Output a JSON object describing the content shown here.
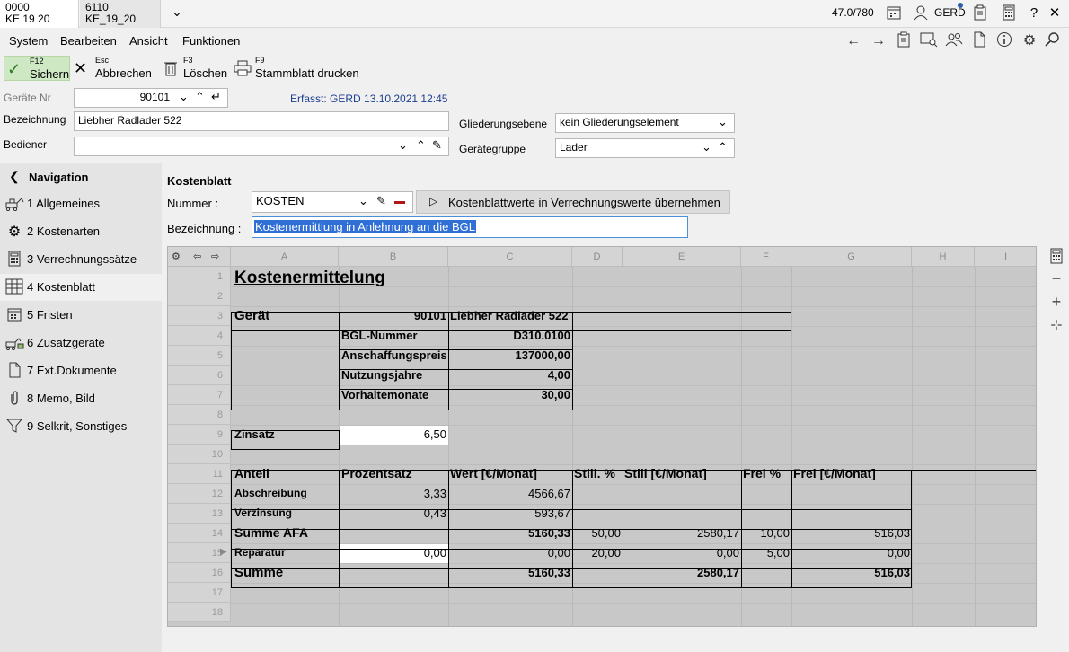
{
  "tabs": [
    {
      "line1": "0000",
      "line2": "KE 19 20"
    },
    {
      "line1": "6110",
      "line2": "KE_19_20"
    }
  ],
  "topbar": {
    "counter": "47.0/780",
    "user": "GERD",
    "icons": [
      "chevron-down-icon",
      "calendar-icon",
      "user-icon",
      "clipboard-icon",
      "calculator-icon",
      "help-icon",
      "close-icon"
    ]
  },
  "menu": [
    "System",
    "Bearbeiten",
    "Ansicht",
    "Funktionen"
  ],
  "toolbar": {
    "save": {
      "key": "F12",
      "label": "Sichern"
    },
    "cancel": {
      "key": "Esc",
      "label": "Abbrechen"
    },
    "delete": {
      "key": "F3",
      "label": "Löschen"
    },
    "print": {
      "key": "F9",
      "label": "Stammblatt drucken"
    }
  },
  "form": {
    "geraete_nr_label": "Geräte Nr",
    "geraete_nr": "90101",
    "erfasst": "Erfasst: GERD 13.10.2021 12:45",
    "bezeichnung_label": "Bezeichnung",
    "bezeichnung": "Liebher Radlader 522",
    "bediener_label": "Bediener",
    "bediener": "",
    "gliederung_label": "Gliederungsebene",
    "gliederung": "kein Gliederungselement",
    "geraetegruppe_label": "Gerätegruppe",
    "geraetegruppe": "Lader"
  },
  "sidebar": {
    "title": "Navigation",
    "items": [
      {
        "label": "1 Allgemeines",
        "icon": "excavator-icon"
      },
      {
        "label": "2 Kostenarten",
        "icon": "gears-icon"
      },
      {
        "label": "3 Verrechnungssätze",
        "icon": "calculator-icon"
      },
      {
        "label": "4 Kostenblatt",
        "icon": "grid-icon"
      },
      {
        "label": "5 Fristen",
        "icon": "calendar-icon"
      },
      {
        "label": "6 Zusatzgeräte",
        "icon": "machines-icon"
      },
      {
        "label": "7 Ext.Dokumente",
        "icon": "document-icon"
      },
      {
        "label": "8 Memo, Bild",
        "icon": "paperclip-icon"
      },
      {
        "label": "9 Selkrit, Sonstiges",
        "icon": "filter-icon"
      }
    ]
  },
  "kostenblatt": {
    "title": "Kostenblatt",
    "nummer_label": "Nummer :",
    "nummer": "KOSTEN",
    "apply_button": "Kostenblattwerte in Verrechnungswerte übernehmen",
    "bezeichnung_label": "Bezeichnung :",
    "bezeichnung": "Kostenermittlung in Anlehnung an die BGL"
  },
  "sheet": {
    "columns": [
      "A",
      "B",
      "C",
      "D",
      "E",
      "F",
      "G",
      "H",
      "I"
    ],
    "rows": [
      "1",
      "2",
      "3",
      "4",
      "5",
      "6",
      "7",
      "8",
      "9",
      "10",
      "11",
      "12",
      "13",
      "14",
      "15",
      "16",
      "17",
      "18"
    ],
    "title": "Kostenermittelung",
    "geraet_label": "Gerät",
    "geraet_nr": "90101",
    "geraet_name": "Liebher Radlader 522",
    "bgl_label": "BGL-Nummer",
    "bgl": "D310.0100",
    "anschaffung_label": "Anschaffungspreis",
    "anschaffung": "137000,00",
    "nutzung_label": "Nutzungsjahre",
    "nutzung": "4,00",
    "vorhalte_label": "Vorhaltemonate",
    "vorhalte": "30,00",
    "zinsatz_label": "Zinsatz",
    "zinsatz": "6,50",
    "headers": [
      "Anteil",
      "Prozentsatz",
      "Wert [€/Monat]",
      "Still. %",
      "Still [€/Monat]",
      "Frei %",
      "Frei [€/Monat]"
    ],
    "abschreibung": [
      "Abschreibung",
      "3,33",
      "4566,67"
    ],
    "verzinsung": [
      "Verzinsung",
      "0,43",
      "593,67"
    ],
    "summe_afa": [
      "Summe AFA",
      "5160,33",
      "50,00",
      "2580,17",
      "10,00",
      "516,03"
    ],
    "reparatur": [
      "Reparatur",
      "0,00",
      "0,00",
      "20,00",
      "0,00",
      "5,00",
      "0,00"
    ],
    "summe": [
      "Summe",
      "5160,33",
      "2580,17",
      "516,03"
    ]
  }
}
